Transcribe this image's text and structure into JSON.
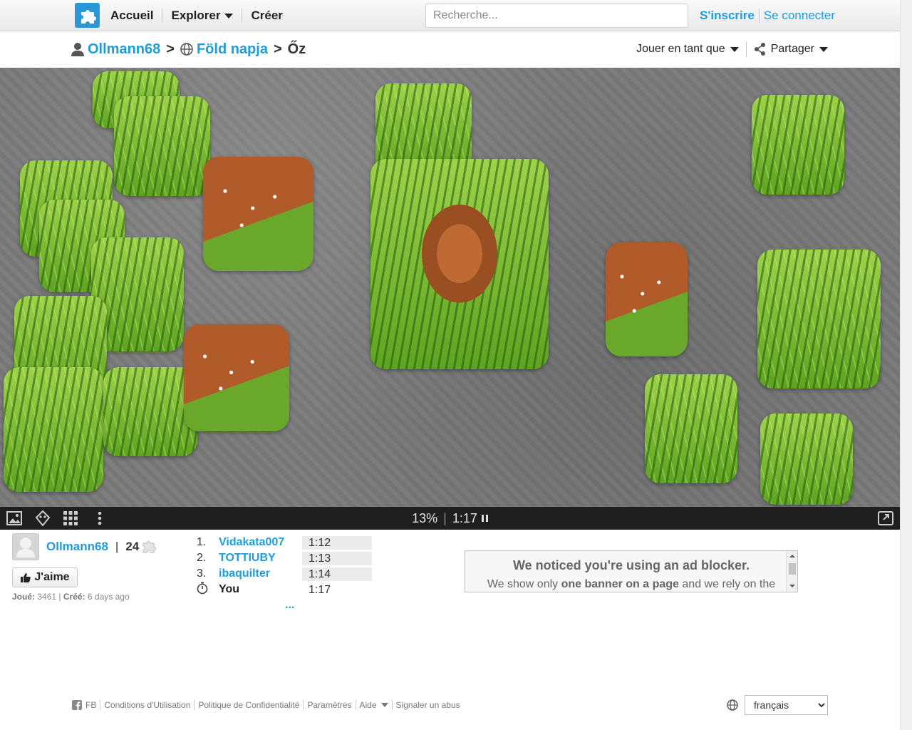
{
  "header": {
    "nav": {
      "home": "Accueil",
      "explore": "Explorer",
      "create": "Créer"
    },
    "search_placeholder": "Recherche...",
    "signup": "S'inscrire",
    "login": "Se connecter"
  },
  "breadcrumb": {
    "user": "Ollmann68",
    "album": "Föld napja",
    "puzzle": "Őz"
  },
  "actions": {
    "play_as": "Jouer en tant que",
    "share": "Partager"
  },
  "board": {
    "progress": "13%",
    "separator": "|",
    "timer": "1:17"
  },
  "author": {
    "name": "Ollmann68",
    "pipe": "|",
    "puzzle_count": "24"
  },
  "like_button": "J'aime",
  "stats": {
    "played_label": "Joué:",
    "played": "3461",
    "sep": "|",
    "created_label": "Créé:",
    "created": "6 days ago"
  },
  "leaderboard": {
    "rows": [
      {
        "rank": "1.",
        "player": "Vidakata007",
        "time": "1:12"
      },
      {
        "rank": "2.",
        "player": "TOTTIUBY",
        "time": "1:13"
      },
      {
        "rank": "3.",
        "player": "ibaquilter",
        "time": "1:14"
      }
    ],
    "you": {
      "player": "You",
      "time": "1:17"
    },
    "more": "..."
  },
  "ad_notice": {
    "title": "We noticed you're using an ad blocker.",
    "text_a": "We show only ",
    "text_b": "one banner on a page",
    "text_c": " and we rely on the"
  },
  "footer": {
    "fb": "FB",
    "terms": "Conditions d'Utilisation",
    "privacy": "Politique de Confidentialité",
    "settings": "Paramètres",
    "help": "Aide",
    "report": "Signaler un abus",
    "language": "français"
  },
  "colors": {
    "link": "#1f9ddb",
    "logo": "#2a97d6",
    "board_bg": "#7a7a7a",
    "toolbar": "#1f1f1f"
  }
}
